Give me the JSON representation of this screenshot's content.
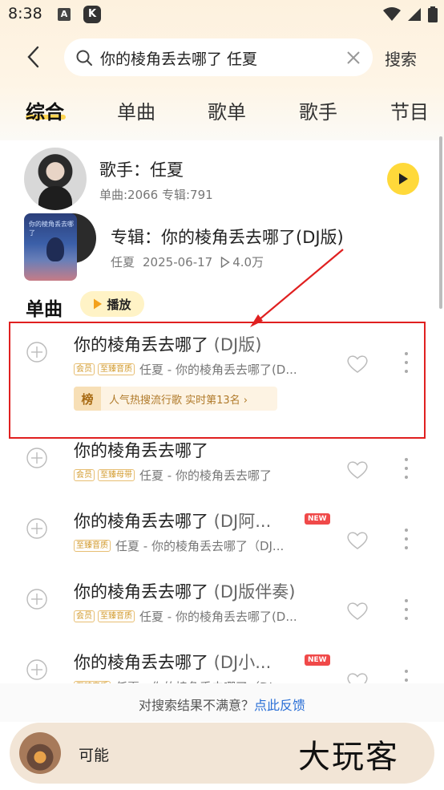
{
  "status_bar": {
    "time": "8:38",
    "a_icon": "A",
    "k_icon": "K"
  },
  "search": {
    "query": "你的棱角丢去哪了  任夏",
    "submit_label": "搜索"
  },
  "tabs": [
    {
      "label": "综合",
      "active": true
    },
    {
      "label": "单曲"
    },
    {
      "label": "歌单"
    },
    {
      "label": "歌手"
    },
    {
      "label": "节目"
    }
  ],
  "singer": {
    "title": "歌手：任夏",
    "meta": "单曲:2066  专辑:791"
  },
  "album": {
    "title": "专辑：你的棱角丢去哪了(DJ版)",
    "cover_text": "你的棱角丢去哪了",
    "artist": "任夏",
    "date": "2025-06-17",
    "plays": "4.0万"
  },
  "section": {
    "title": "单曲",
    "play_label": "播放"
  },
  "songs": [
    {
      "title": "你的棱角丢去哪了",
      "suffix": " (DJ版)",
      "tags": [
        "会员",
        "至臻音质"
      ],
      "artist_line": "任夏 - 你的棱角丢去哪了(D..."
    },
    {
      "title": "你的棱角丢去哪了",
      "suffix": "",
      "tags": [
        "会员",
        "至臻母带"
      ],
      "artist_line": "任夏 - 你的棱角丢去哪了"
    },
    {
      "title": "你的棱角丢去哪了",
      "suffix": " (DJ阿...",
      "tags": [
        "至臻音质"
      ],
      "artist_line": "任夏 - 你的棱角丢去哪了（DJ...",
      "badge": "NEW"
    },
    {
      "title": "你的棱角丢去哪了",
      "suffix": " (DJ版伴奏)",
      "tags": [
        "会员",
        "至臻音质"
      ],
      "artist_line": "任夏 - 你的棱角丢去哪了(D..."
    },
    {
      "title": "你的棱角丢去哪了",
      "suffix": " (DJ小...",
      "tags": [
        "至臻音质"
      ],
      "artist_line": "任夏 - 你的棱角丢去哪了（DJ...",
      "badge": "NEW"
    }
  ],
  "rank": {
    "badge": "榜",
    "text": "人气热搜流行歌  实时第13名 ›"
  },
  "feedback": {
    "text": "对搜索结果不满意？",
    "link": "点此反馈"
  },
  "player": {
    "title": "可能"
  },
  "watermark": "大玩客",
  "colors": {
    "accent_yellow": "#ffd93a",
    "highlight_red": "#e02020",
    "link_blue": "#2a6fd6",
    "new_badge_red": "#f04949"
  }
}
